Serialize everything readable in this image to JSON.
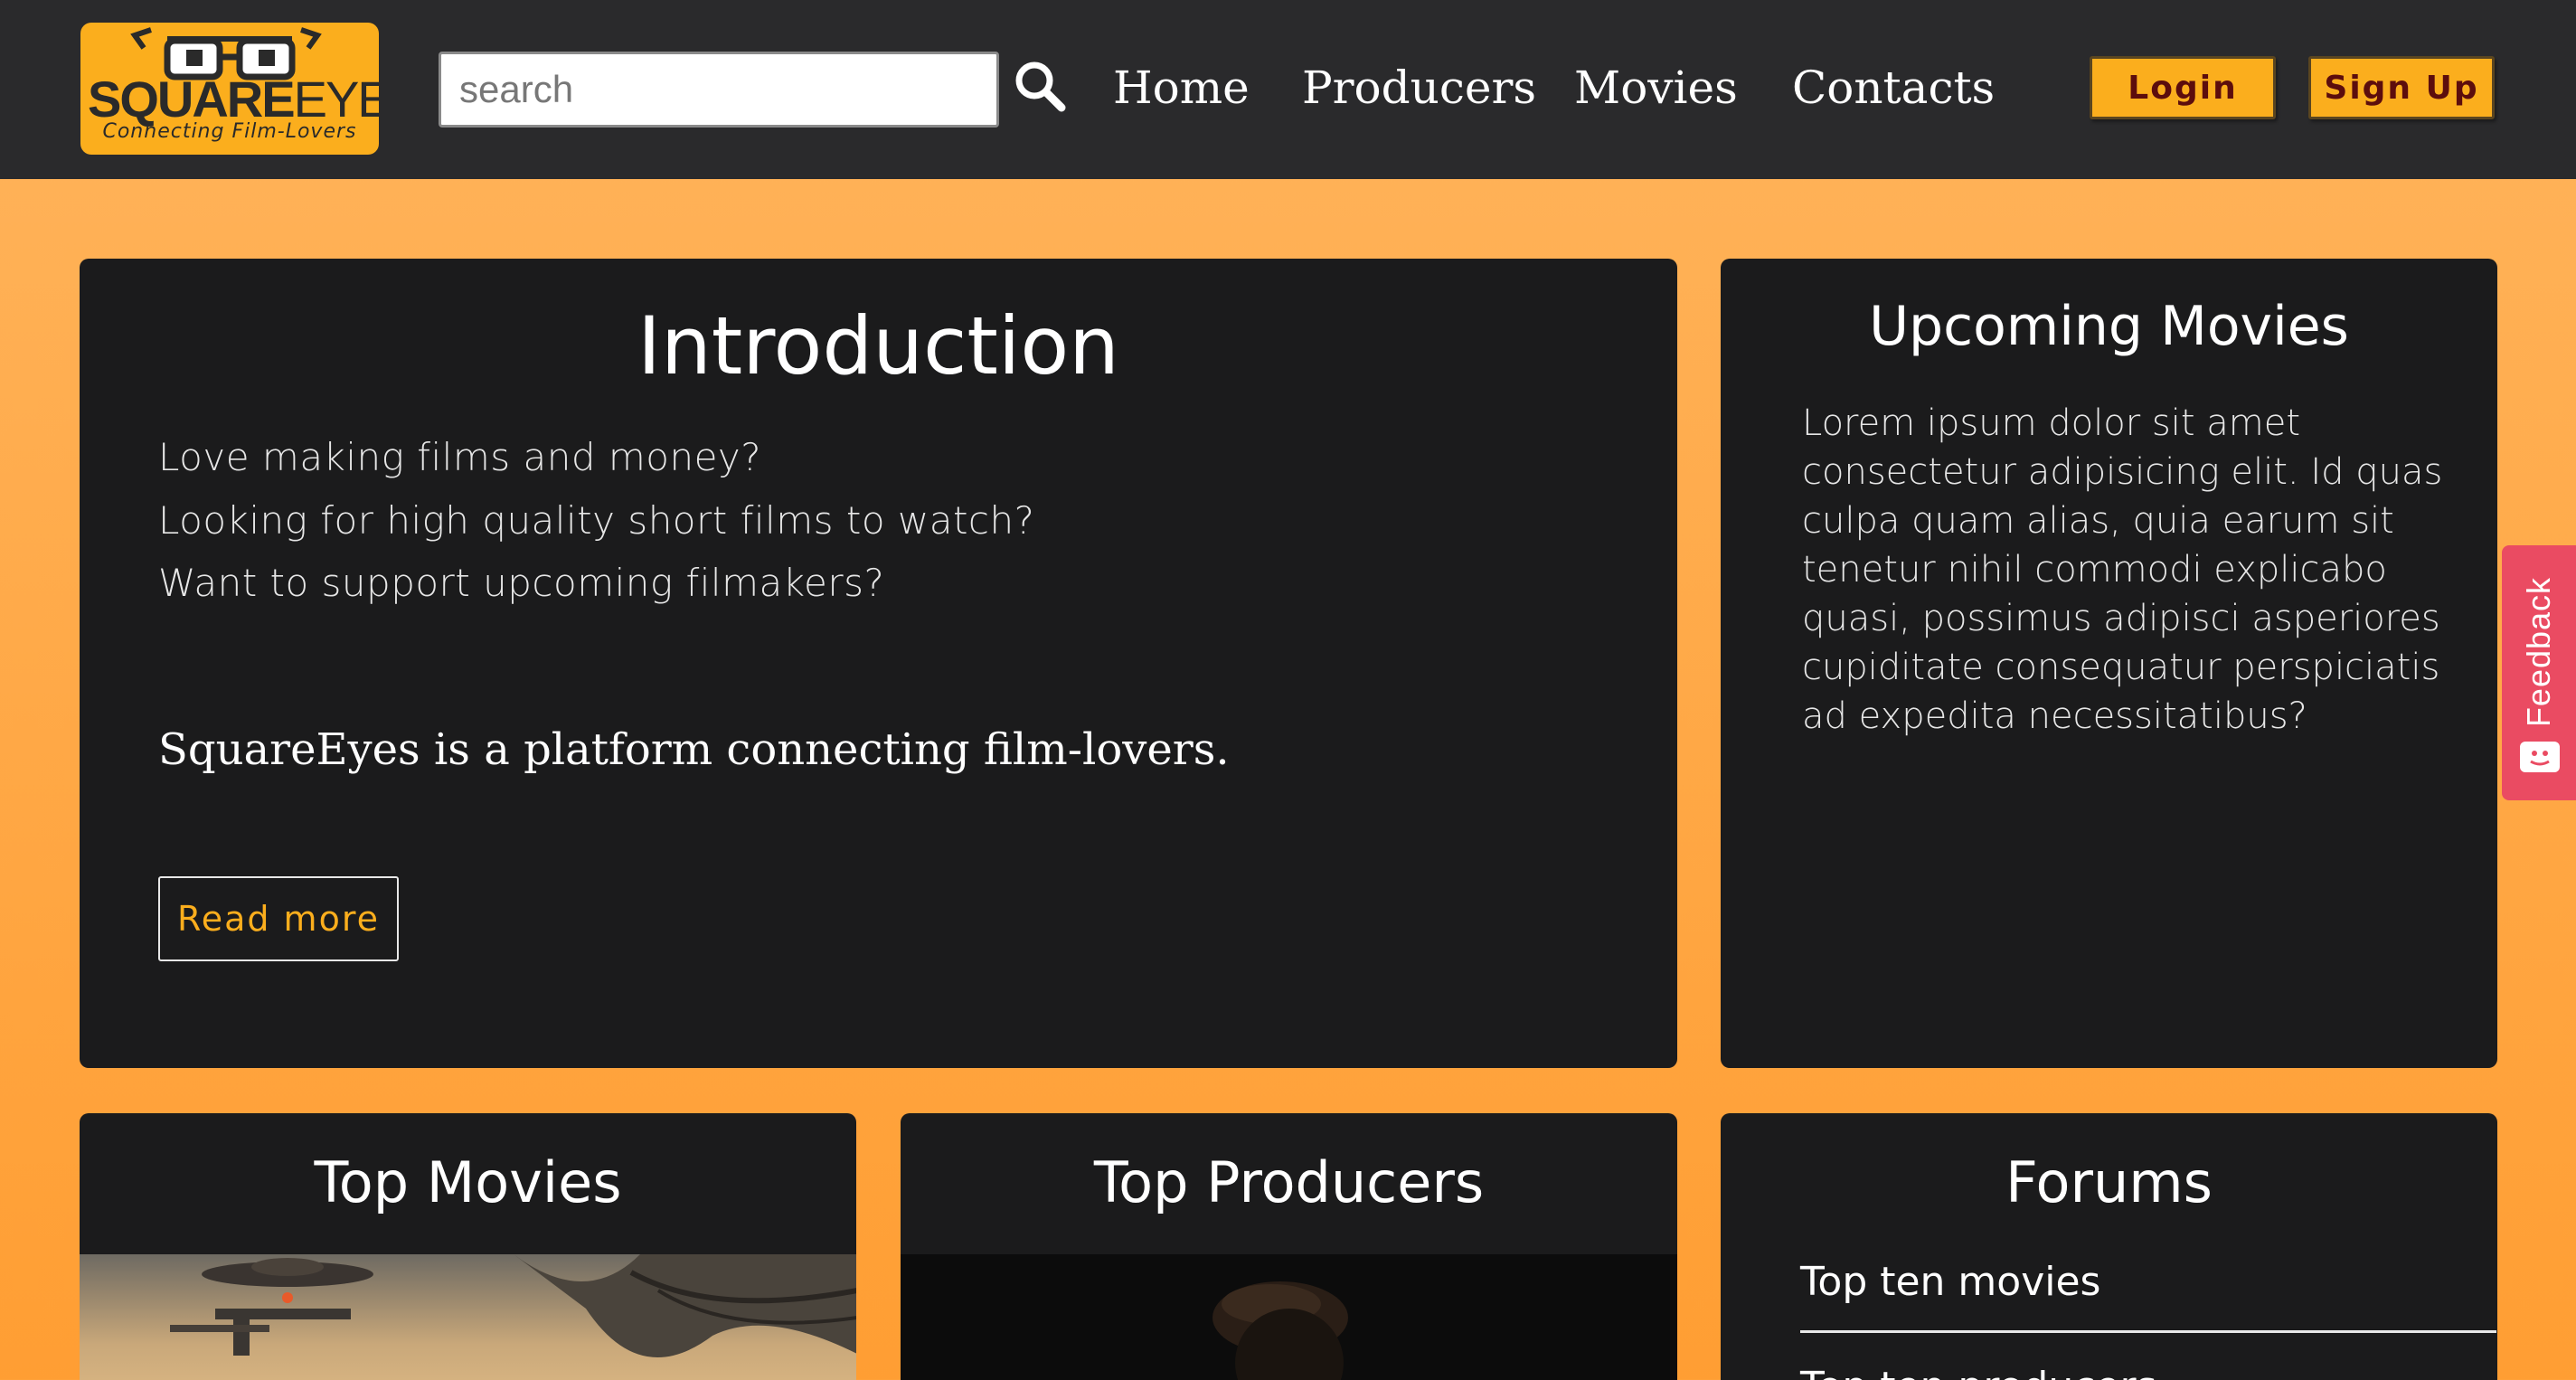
{
  "header": {
    "logo": {
      "main_bold": "SQUARE",
      "main_thin": "EYES",
      "tagline": "Connecting Film-Lovers"
    },
    "search": {
      "placeholder": "search",
      "value": ""
    },
    "nav": [
      {
        "label": "Home"
      },
      {
        "label": "Producers"
      },
      {
        "label": "Movies"
      },
      {
        "label": "Contacts"
      }
    ],
    "login_label": "Login",
    "signup_label": "Sign Up"
  },
  "intro": {
    "title": "Introduction",
    "lines": [
      "Love making films and money?",
      "Looking for high quality short films to watch?",
      "Want to support upcoming filmakers?"
    ],
    "tagline": "SquareEyes is a platform connecting film-lovers.",
    "read_more_label": "Read more"
  },
  "upcoming": {
    "title": "Upcoming Movies",
    "text": "Lorem ipsum dolor sit amet consectetur adipisicing elit. Id quas culpa quam alias, quia earum sit tenetur nihil commodi explicabo quasi, possimus adipisci asperiores cupiditate consequatur perspiciatis ad expedita necessitatibus?"
  },
  "top_movies": {
    "title": "Top Movies"
  },
  "top_producers": {
    "title": "Top Producers"
  },
  "forums": {
    "title": "Forums",
    "items": [
      {
        "label": "Top ten movies"
      },
      {
        "label": "Top ten producers"
      }
    ]
  },
  "feedback": {
    "label": "Feedback"
  },
  "colors": {
    "accent": "#fbae1d",
    "header_bg": "#2a2a2c",
    "card_bg": "#1b1b1c",
    "feedback": "#ea4b62"
  }
}
